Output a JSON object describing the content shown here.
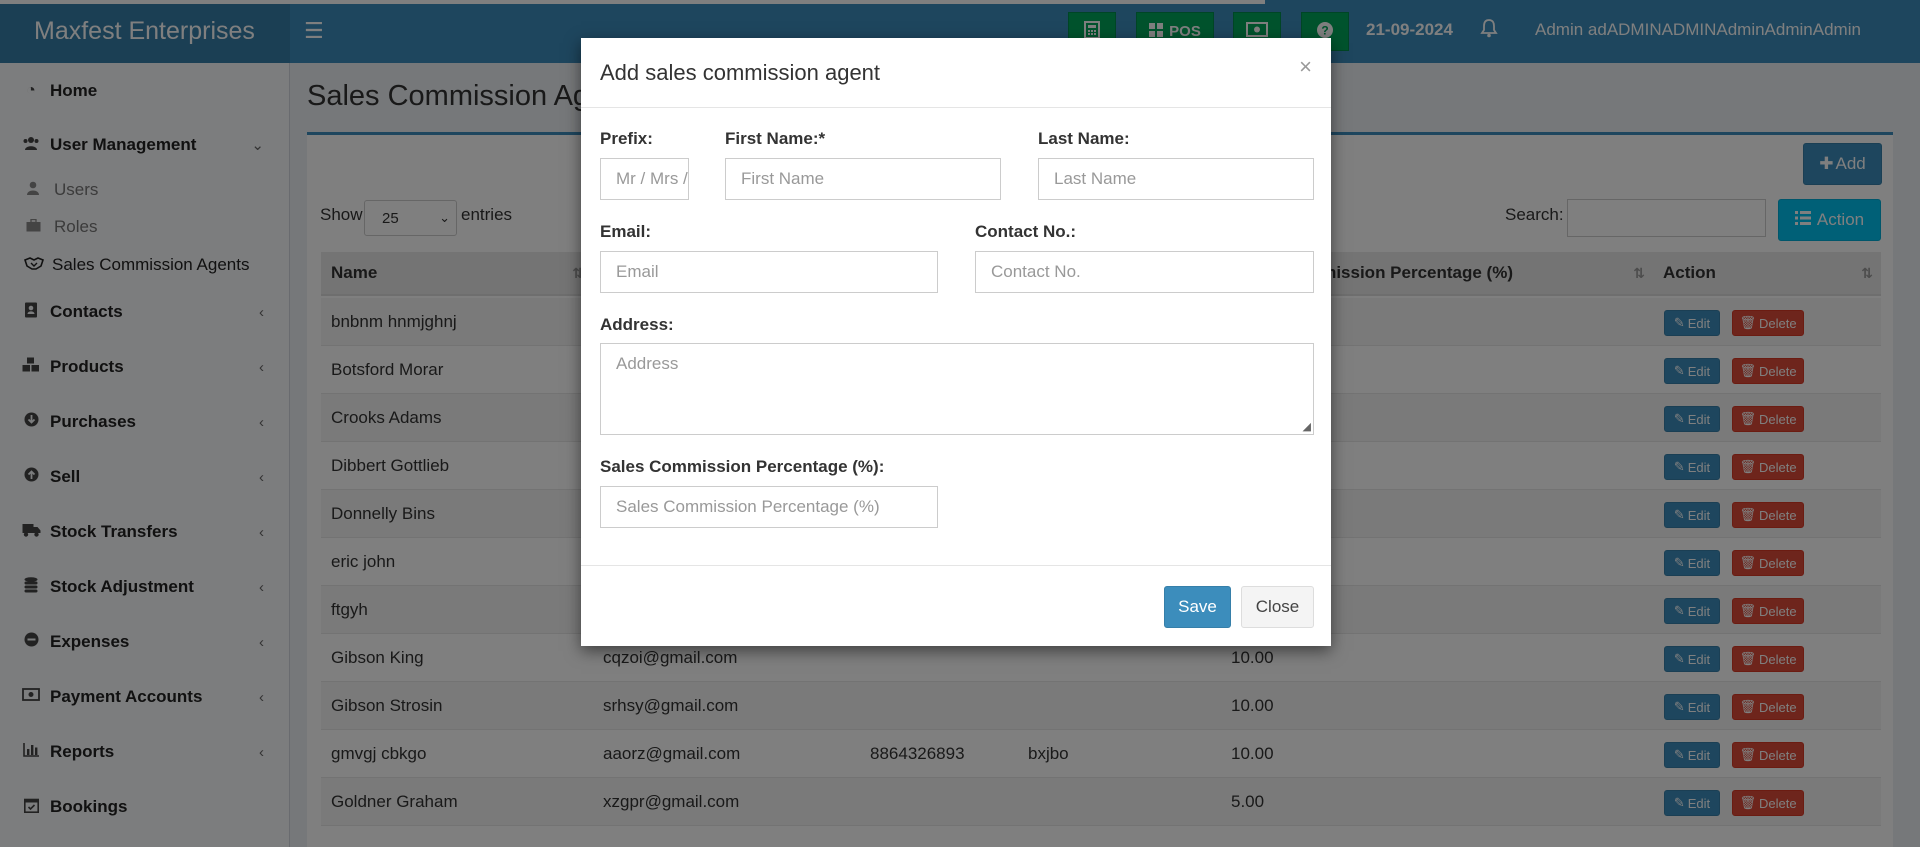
{
  "header": {
    "brand": "Maxfest Enterprises",
    "menu_icon": "hamburger-icon",
    "calculator_icon": "calculator-icon",
    "pos_label": "POS",
    "cash_icon": "money-icon",
    "help_icon": "question-icon",
    "date": "21-09-2024",
    "bell_icon": "bell-icon",
    "user_name": "Admin adADMINADMINAdminAdminAdmin"
  },
  "sidebar": {
    "items": [
      {
        "label": "Home",
        "icon": "dashboard-icon"
      },
      {
        "label": "User Management",
        "icon": "users-icon"
      },
      {
        "label": "Users",
        "icon": "user-icon"
      },
      {
        "label": "Roles",
        "icon": "briefcase-icon"
      },
      {
        "label": "Sales Commission Agents",
        "icon": "handshake-icon"
      },
      {
        "label": "Contacts",
        "icon": "address-book-icon"
      },
      {
        "label": "Products",
        "icon": "cubes-icon"
      },
      {
        "label": "Purchases",
        "icon": "arrow-circle-down-icon"
      },
      {
        "label": "Sell",
        "icon": "arrow-circle-up-icon"
      },
      {
        "label": "Stock Transfers",
        "icon": "truck-icon"
      },
      {
        "label": "Stock Adjustment",
        "icon": "database-icon"
      },
      {
        "label": "Expenses",
        "icon": "minus-circle-icon"
      },
      {
        "label": "Payment Accounts",
        "icon": "money-icon"
      },
      {
        "label": "Reports",
        "icon": "bar-chart-icon"
      },
      {
        "label": "Bookings",
        "icon": "calendar-check-icon"
      }
    ]
  },
  "page": {
    "title": "Sales Commission Agents",
    "add_label": "Add",
    "show_label": "Show",
    "entries_value": "25",
    "entries_label": "entries",
    "search_label": "Search:",
    "action_label": "Action"
  },
  "table": {
    "headers": {
      "name": "Name",
      "commission": "Sales Commission Percentage (%)",
      "action": "Action"
    },
    "edit_label": "Edit",
    "delete_label": "Delete",
    "rows": [
      {
        "name": "bnbnm hnmjghnj",
        "email": "",
        "contact": "",
        "address": "",
        "commission": ""
      },
      {
        "name": "Botsford Morar",
        "email": "",
        "contact": "",
        "address": "",
        "commission": ""
      },
      {
        "name": "Crooks Adams",
        "email": "",
        "contact": "",
        "address": "",
        "commission": ""
      },
      {
        "name": "Dibbert Gottlieb",
        "email": "",
        "contact": "",
        "address": "",
        "commission": ""
      },
      {
        "name": "Donnelly Bins",
        "email": "",
        "contact": "",
        "address": "",
        "commission": ""
      },
      {
        "name": "eric john",
        "email": "",
        "contact": "",
        "address": "",
        "commission": ""
      },
      {
        "name": "ftgyh",
        "email": "",
        "contact": "",
        "address": "",
        "commission": ""
      },
      {
        "name": "Gibson King",
        "email": "cqzoi@gmail.com",
        "contact": "",
        "address": "",
        "commission": "10.00"
      },
      {
        "name": "Gibson Strosin",
        "email": "srhsy@gmail.com",
        "contact": "",
        "address": "",
        "commission": "10.00"
      },
      {
        "name": "gmvgj cbkgo",
        "email": "aaorz@gmail.com",
        "contact": "8864326893",
        "address": "bxjbo",
        "commission": "10.00"
      },
      {
        "name": "Goldner Graham",
        "email": "xzgpr@gmail.com",
        "contact": "",
        "address": "",
        "commission": "5.00"
      }
    ]
  },
  "modal": {
    "title": "Add sales commission agent",
    "close_symbol": "×",
    "prefix_label": "Prefix:",
    "prefix_placeholder": "Mr / Mrs / Miss",
    "first_name_label": "First Name:*",
    "first_name_placeholder": "First Name",
    "last_name_label": "Last Name:",
    "last_name_placeholder": "Last Name",
    "email_label": "Email:",
    "email_placeholder": "Email",
    "contact_label": "Contact No.:",
    "contact_placeholder": "Contact No.",
    "address_label": "Address:",
    "address_placeholder": "Address",
    "commission_label": "Sales Commission Percentage (%):",
    "commission_placeholder": "Sales Commission Percentage (%)",
    "save_label": "Save",
    "close_label": "Close"
  }
}
